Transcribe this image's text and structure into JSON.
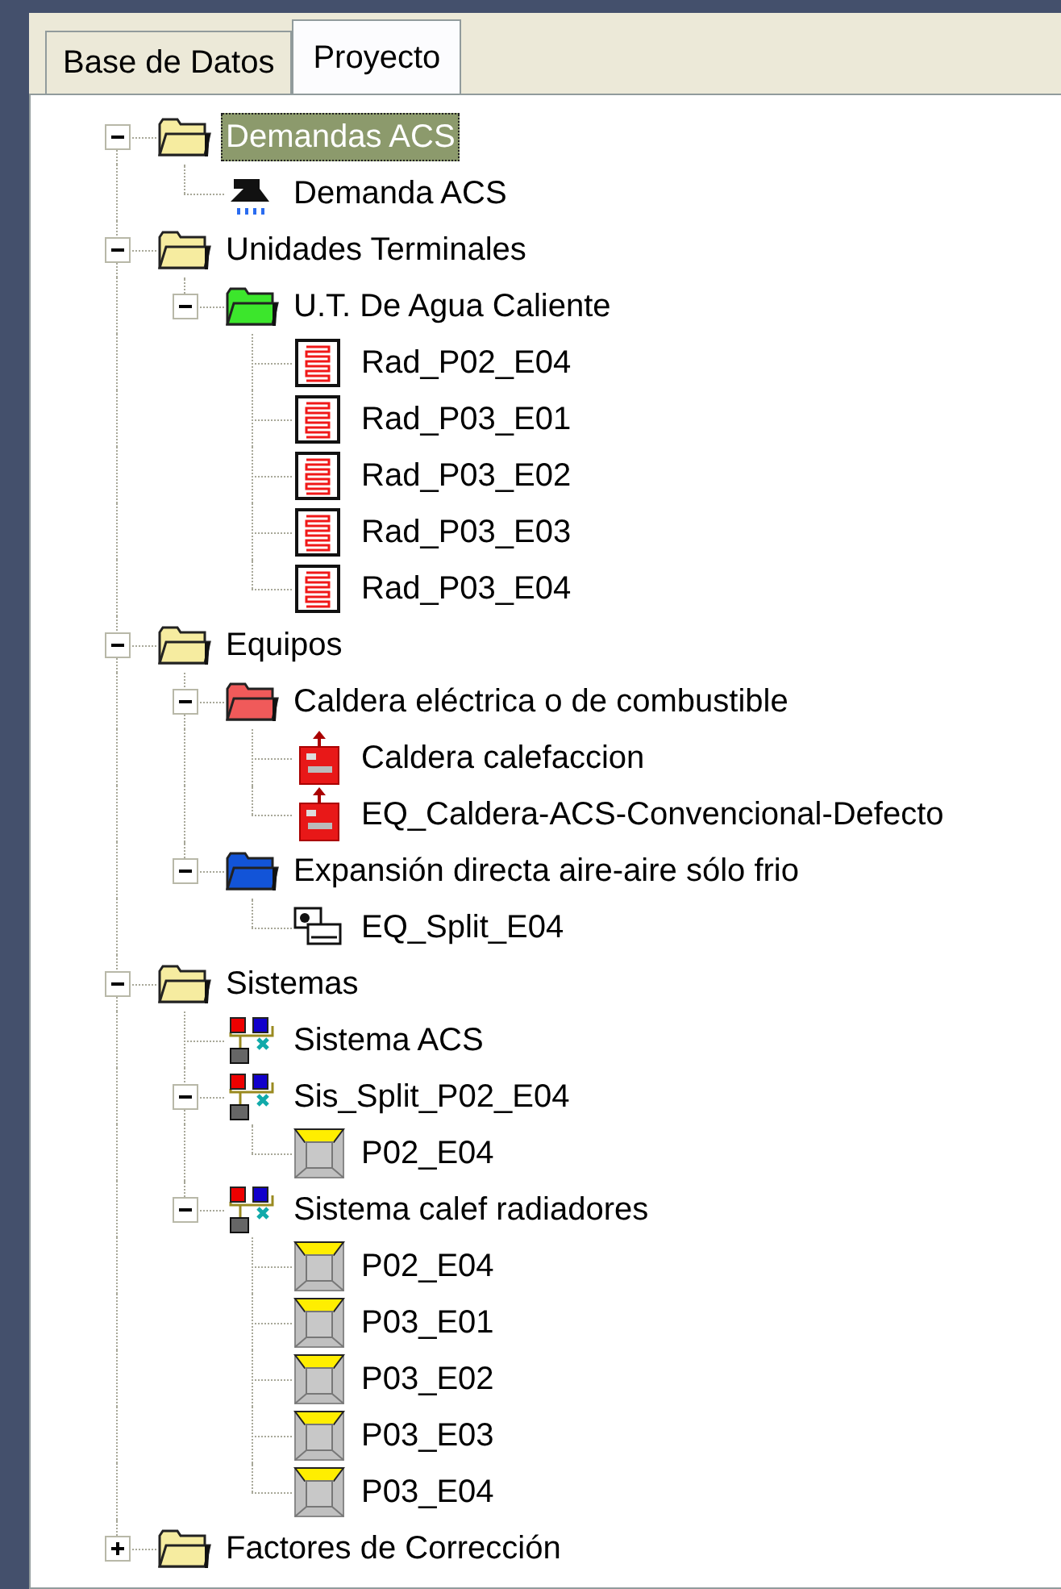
{
  "tabs": [
    {
      "label": "Base de Datos",
      "selected": false
    },
    {
      "label": "Proyecto",
      "selected": true
    }
  ],
  "tree": [
    {
      "label": "Demandas ACS",
      "kind": "folder",
      "color": "#f6eca0",
      "selected": true,
      "expanded": true,
      "children": [
        {
          "label": "Demanda ACS",
          "kind": "shower",
          "selected": false
        }
      ]
    },
    {
      "label": "Unidades Terminales",
      "kind": "folder",
      "color": "#f6eca0",
      "selected": false,
      "expanded": true,
      "children": [
        {
          "label": "U.T. De Agua Caliente",
          "kind": "folder",
          "color": "#3ce62c",
          "selected": false,
          "expanded": true,
          "children": [
            {
              "label": "Rad_P02_E04",
              "kind": "radiator",
              "selected": false
            },
            {
              "label": "Rad_P03_E01",
              "kind": "radiator",
              "selected": false
            },
            {
              "label": "Rad_P03_E02",
              "kind": "radiator",
              "selected": false
            },
            {
              "label": "Rad_P03_E03",
              "kind": "radiator",
              "selected": false
            },
            {
              "label": "Rad_P03_E04",
              "kind": "radiator",
              "selected": false
            }
          ]
        }
      ]
    },
    {
      "label": "Equipos",
      "kind": "folder",
      "color": "#f6eca0",
      "selected": false,
      "expanded": true,
      "children": [
        {
          "label": "Caldera eléctrica o de combustible",
          "kind": "folder",
          "color": "#f05a5a",
          "selected": false,
          "expanded": true,
          "children": [
            {
              "label": "Caldera calefaccion",
              "kind": "boiler",
              "selected": false
            },
            {
              "label": "EQ_Caldera-ACS-Convencional-Defecto",
              "kind": "boiler",
              "selected": false
            }
          ]
        },
        {
          "label": "Expansión directa aire-aire sólo frio",
          "kind": "folder",
          "color": "#1254d8",
          "selected": false,
          "expanded": true,
          "children": [
            {
              "label": "EQ_Split_E04",
              "kind": "split",
              "selected": false
            }
          ]
        }
      ]
    },
    {
      "label": "Sistemas",
      "kind": "folder",
      "color": "#f6eca0",
      "selected": false,
      "expanded": true,
      "children": [
        {
          "label": "Sistema ACS",
          "kind": "system",
          "selected": false
        },
        {
          "label": "Sis_Split_P02_E04",
          "kind": "system",
          "selected": false,
          "expanded": true,
          "children": [
            {
              "label": "P02_E04",
              "kind": "space",
              "selected": false
            }
          ]
        },
        {
          "label": "Sistema calef radiadores",
          "kind": "system",
          "selected": false,
          "expanded": true,
          "children": [
            {
              "label": "P02_E04",
              "kind": "space",
              "selected": false
            },
            {
              "label": "P03_E01",
              "kind": "space",
              "selected": false
            },
            {
              "label": "P03_E02",
              "kind": "space",
              "selected": false
            },
            {
              "label": "P03_E03",
              "kind": "space",
              "selected": false
            },
            {
              "label": "P03_E04",
              "kind": "space",
              "selected": false
            }
          ]
        }
      ]
    },
    {
      "label": "Factores de Corrección",
      "kind": "folder",
      "color": "#f6eca0",
      "selected": false,
      "expanded": false
    }
  ]
}
